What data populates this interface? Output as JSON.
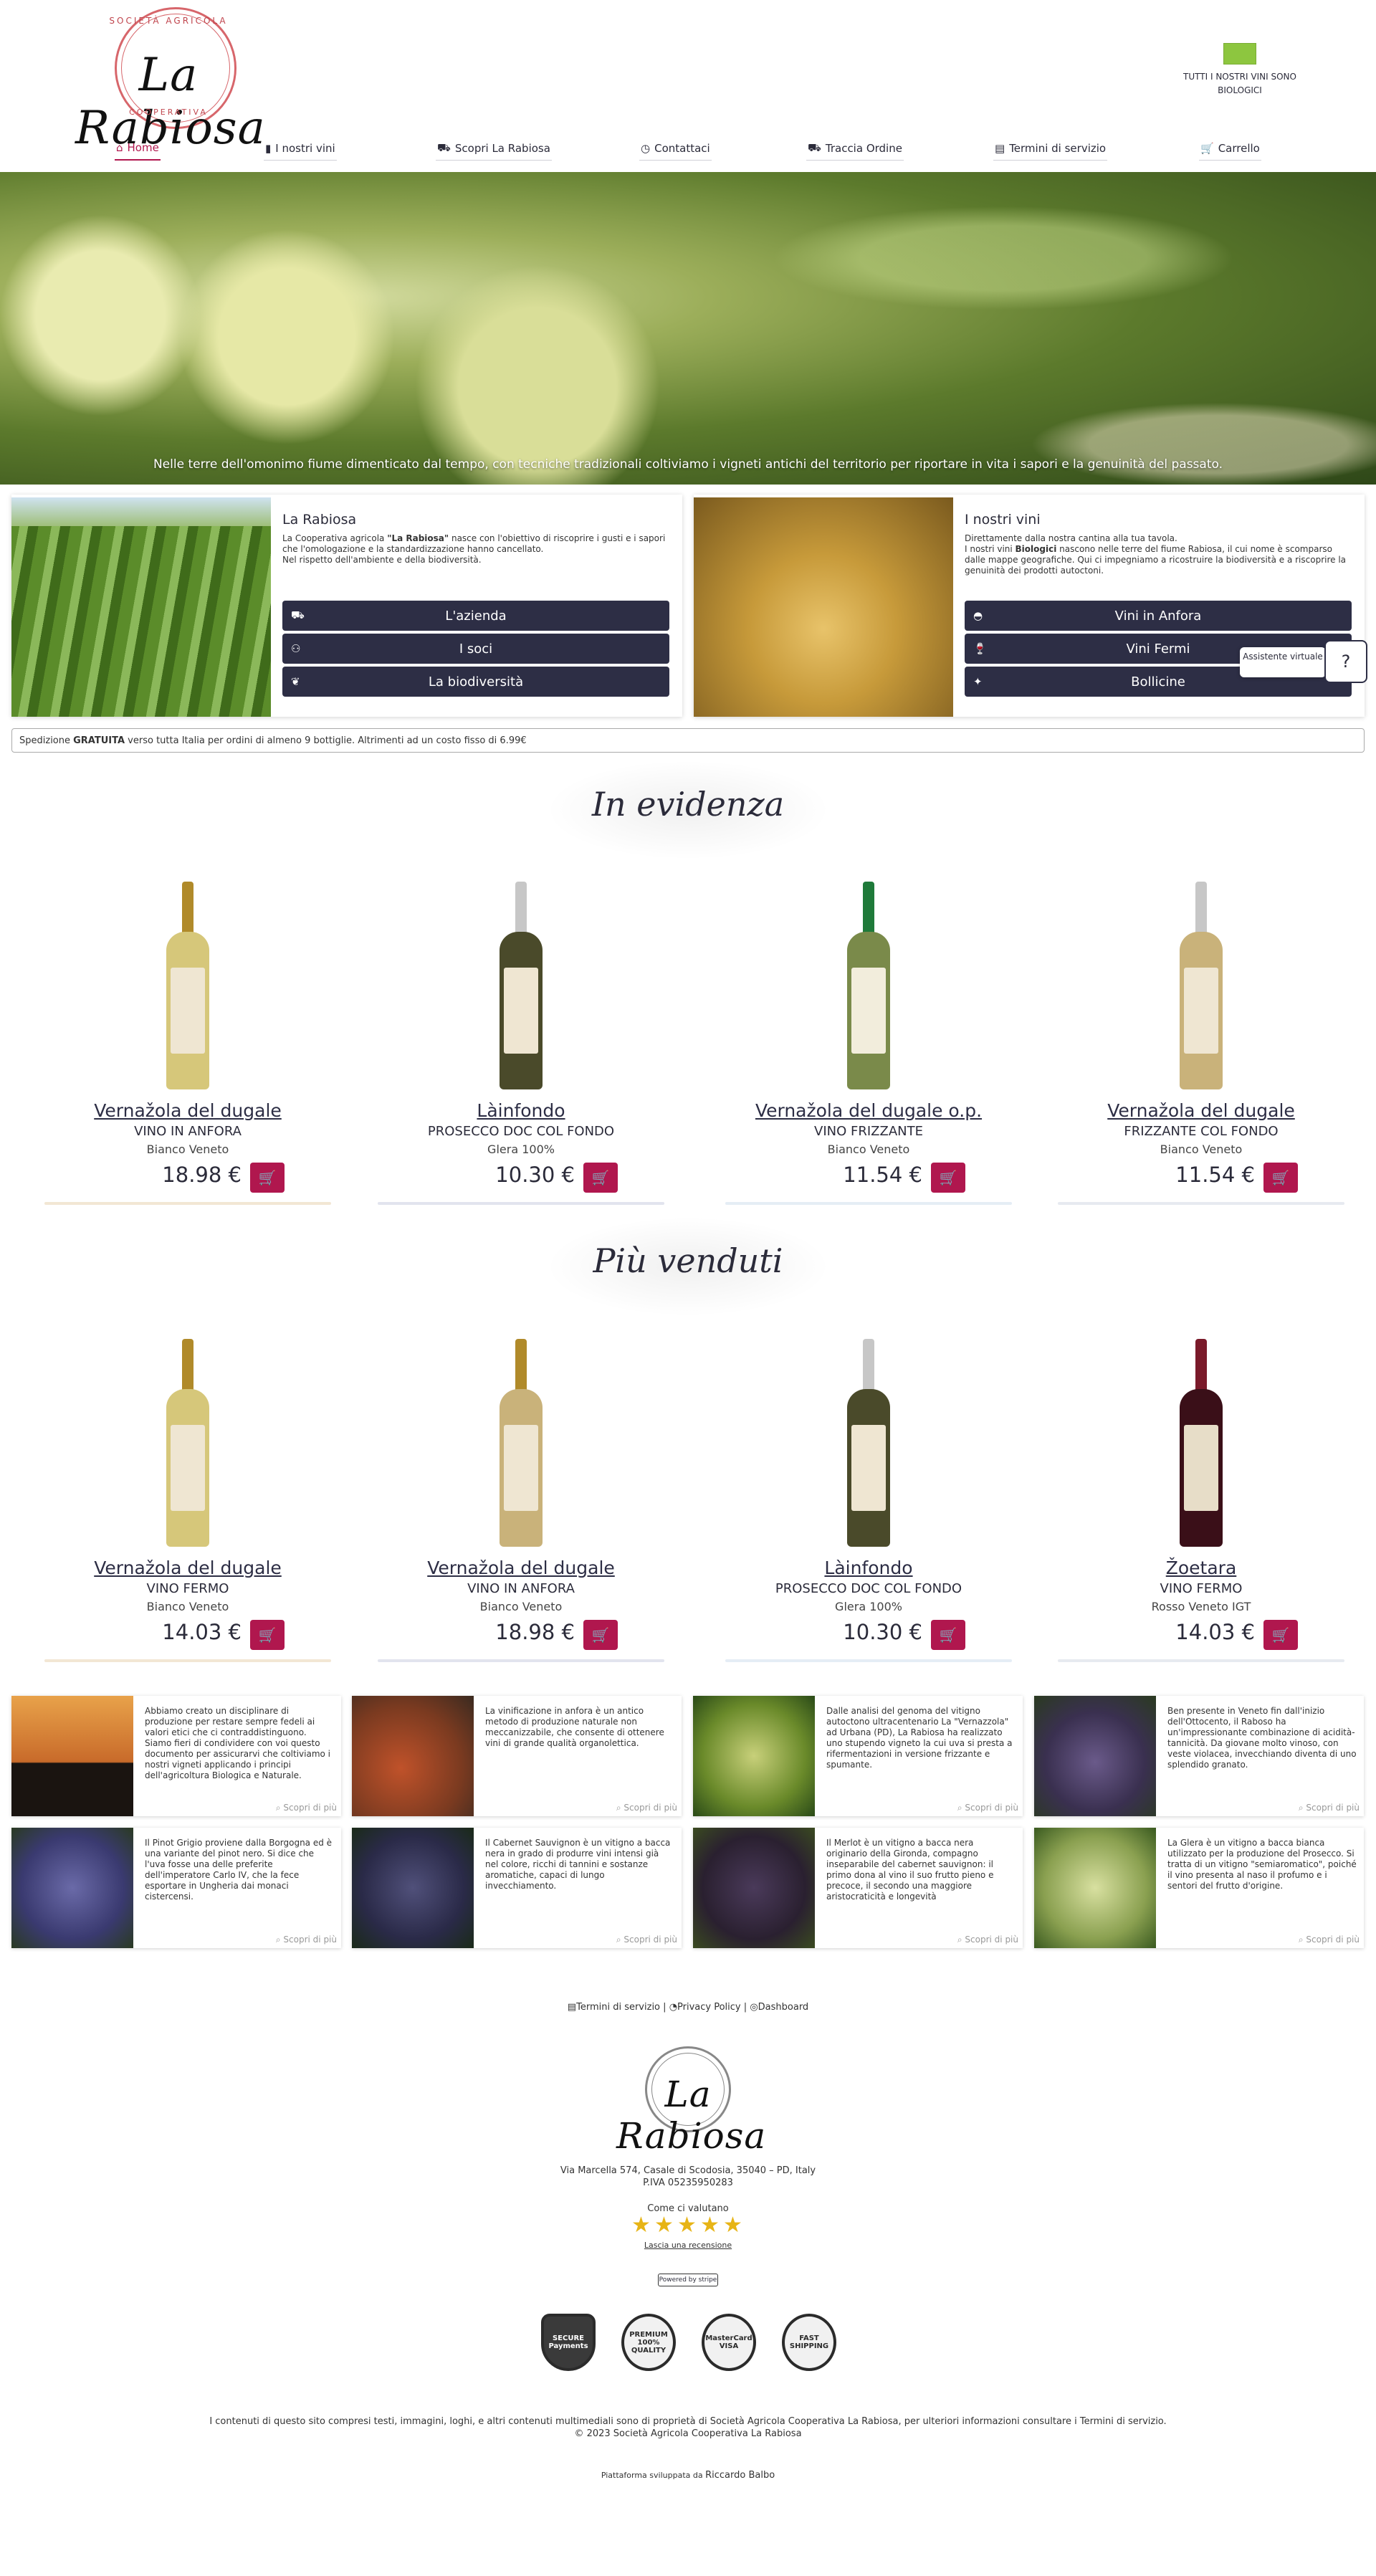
{
  "header": {
    "logo": {
      "top": "SOCIETÀ AGRICOLA",
      "name": "La Rabiosa",
      "bottom": "COOPERATIVA"
    },
    "bio_text": "TUTTI I NOSTRI VINI SONO BIOLOGICI",
    "nav": [
      {
        "label": "Home",
        "icon": "home-icon"
      },
      {
        "label": "I nostri vini",
        "icon": "bottles-icon"
      },
      {
        "label": "Scopri La Rabiosa",
        "icon": "tractor-icon"
      },
      {
        "label": "Contattaci",
        "icon": "clock-icon"
      },
      {
        "label": "Traccia Ordine",
        "icon": "truck-icon"
      },
      {
        "label": "Termini di servizio",
        "icon": "document-icon"
      },
      {
        "label": "Carrello",
        "icon": "cart-icon"
      }
    ]
  },
  "hero": {
    "caption": "Nelle terre dell'omonimo fiume dimenticato dal tempo, con tecniche tradizionali coltiviamo i vigneti antichi del territorio per riportare in vita i sapori e la genuinità del passato."
  },
  "info_cards": [
    {
      "title": "La Rabiosa",
      "desc_1": "La Cooperativa agricola ",
      "desc_bold": "\"La Rabiosa\"",
      "desc_2": " nasce con l'obiettivo di riscoprire i gusti e i sapori che l'omologazione e la standardizzazione hanno cancellato.",
      "desc_3": "Nel rispetto dell'ambiente e della biodiversità.",
      "buttons": [
        "L'azienda",
        "I soci",
        "La biodiversità"
      ]
    },
    {
      "title": "I nostri vini",
      "desc_1": "Direttamente dalla nostra cantina alla tua tavola.",
      "desc_2": "I nostri vini ",
      "desc_bold": "Biologici",
      "desc_3": " nascono nelle terre del fiume Rabiosa, il cui nome è scomparso dalle mappe geografiche. Qui ci impegniamo a ricostruire la biodiversità e a riscoprire la genuinità dei prodotti autoctoni.",
      "buttons": [
        "Vini in Anfora",
        "Vini Fermi",
        "Bollicine"
      ]
    }
  ],
  "assistant": {
    "label": "Assistente virtuale"
  },
  "shipping": {
    "pre": "Spedizione ",
    "bold": "GRATUITA",
    "post": " verso tutta Italia per ordini di almeno 9 bottiglie. Altrimenti ad un costo fisso di 6.99€"
  },
  "sections": {
    "featured": "In evidenza",
    "bestsellers": "Più venduti"
  },
  "featured": [
    {
      "name": "Vernažola del dugale",
      "type": "VINO IN ANFORA",
      "sub": "Bianco Veneto",
      "price": "18.98 €"
    },
    {
      "name": "Làinfondo",
      "type": "PROSECCO DOC COL FONDO",
      "sub": "Glera 100%",
      "price": "10.30 €"
    },
    {
      "name": "Vernažola del dugale o.p.",
      "type": "VINO FRIZZANTE",
      "sub": "Bianco Veneto",
      "price": "11.54 €"
    },
    {
      "name": "Vernažola del dugale",
      "type": "FRIZZANTE COL FONDO",
      "sub": "Bianco Veneto",
      "price": "11.54 €"
    }
  ],
  "bestsellers": [
    {
      "name": "Vernažola del dugale",
      "type": "VINO FERMO",
      "sub": "Bianco Veneto",
      "price": "14.03 €"
    },
    {
      "name": "Vernažola del dugale",
      "type": "VINO IN ANFORA",
      "sub": "Bianco Veneto",
      "price": "18.98 €"
    },
    {
      "name": "Làinfondo",
      "type": "PROSECCO DOC COL FONDO",
      "sub": "Glera 100%",
      "price": "10.30 €"
    },
    {
      "name": "Žoetara",
      "type": "VINO FERMO",
      "sub": "Rosso Veneto IGT",
      "price": "14.03 €"
    }
  ],
  "varieties": [
    {
      "text": "Abbiamo creato un disciplinare di produzione per restare sempre fedeli ai valori etici che ci contraddistinguono. Siamo fieri di condividere con voi questo documento per assicurarvi che coltiviamo i nostri vigneti applicando i principi dell'agricoltura Biologica e Naturale."
    },
    {
      "text": "La vinificazione in anfora è un antico metodo di produzione naturale non meccanizzabile, che consente di ottenere vini di grande qualità organolettica."
    },
    {
      "text": "Dalle analisi del genoma del vitigno autoctono ultracentenario La \"Vernazzola\" ad Urbana (PD), La Rabiosa ha realizzato uno stupendo vigneto la cui uva si presta a rifermentazioni in versione frizzante e spumante."
    },
    {
      "text": "Ben presente in Veneto fin dall'inizio dell'Ottocento, il Raboso ha un'impressionante combinazione di acidità-tannicità. Da giovane molto vinoso, con veste violacea, invecchiando diventa di uno splendido granato."
    },
    {
      "text": "Il Pinot Grigio proviene dalla Borgogna ed è una variante del pinot nero. Si dice che l'uva fosse una delle preferite dell'imperatore Carlo IV, che la fece esportare in Ungheria dai monaci cistercensi."
    },
    {
      "text": "Il Cabernet Sauvignon è un vitigno a bacca nera in grado di produrre vini intensi già nel colore, ricchi di tannini e sostanze aromatiche, capaci di lungo invecchiamento."
    },
    {
      "text": "Il Merlot è un vitigno a bacca nera originario della Gironda, compagno inseparabile del cabernet sauvignon: il primo dona al vino il suo frutto pieno e precoce, il secondo una maggiore aristocraticità e longevità"
    },
    {
      "text": "La Glera è un vitigno a bacca bianca utilizzato per la produzione del Prosecco. Si tratta di un vitigno \"semiaromatico\", poiché il vino presenta al naso il profumo e i sentori del frutto d'origine."
    }
  ],
  "more_label": "Scopri di più",
  "footer": {
    "links": [
      "Termini di servizio",
      "Privacy Policy",
      "Dashboard"
    ],
    "separator": "|",
    "address_1": "Via Marcella 574, Casale di Scodosia, 35040 – PD, Italy",
    "address_2": "P.IVA 05235950283",
    "rating_title": "Come ci valutano",
    "rating": 5,
    "review_link": "Lascia una recensione",
    "stripe": "Powered by stripe",
    "badges": [
      "SECURE Payments",
      "PREMIUM 100% QUALITY",
      "MasterCard VISA",
      "FAST SHIPPING"
    ],
    "copyright_1": "I contenuti di questo sito compresi testi, immagini, loghi, e altri contenuti multimediali sono di proprietà di Società Agricola Cooperativa La Rabiosa, per ulteriori informazioni consultare i Termini di servizio.",
    "copyright_2": "© 2023 Società Agricola Cooperativa La Rabiosa",
    "dev_pre": "Piattaforma sviluppata da ",
    "dev_name": "Riccardo Balbo"
  }
}
